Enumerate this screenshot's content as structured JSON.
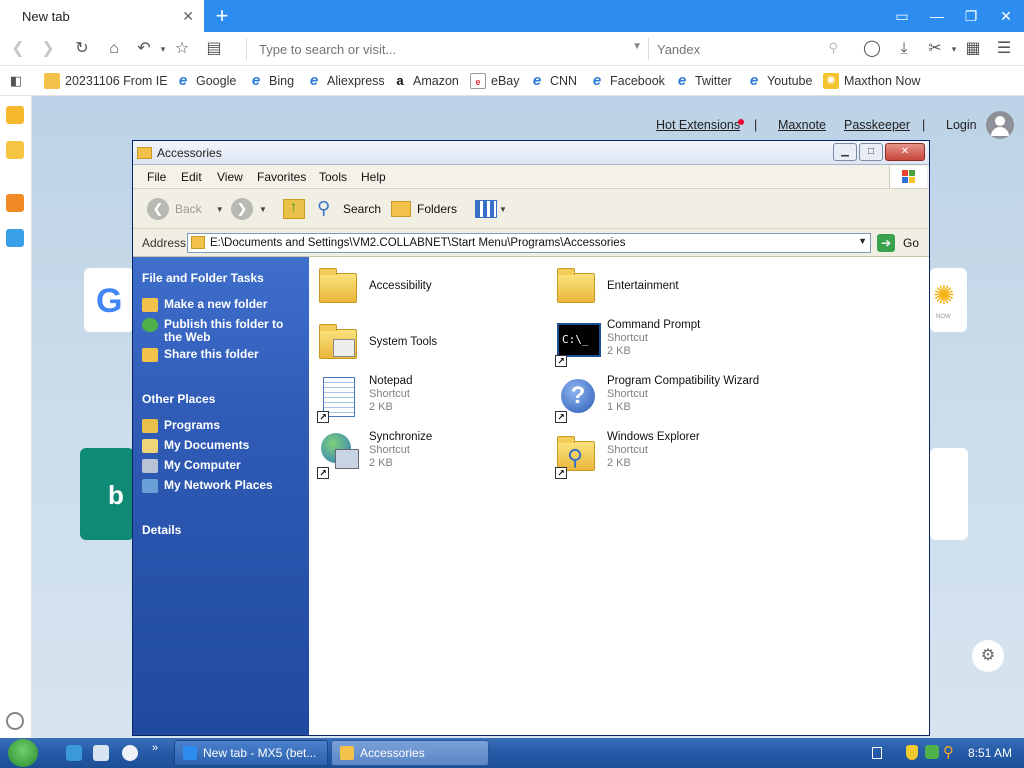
{
  "browser": {
    "tab_title": "New tab",
    "tab_close": "✕",
    "new_tab": "+",
    "url_placeholder": "Type to search or visit...",
    "search_placeholder": "Yandex"
  },
  "bookmarks": [
    {
      "label": "20231106 From IE",
      "icon": "folder-icon"
    },
    {
      "label": "Google",
      "icon": "ie-icon"
    },
    {
      "label": "Bing",
      "icon": "ie-icon"
    },
    {
      "label": "Aliexpress",
      "icon": "ie-icon"
    },
    {
      "label": "Amazon",
      "icon": "amazon-icon"
    },
    {
      "label": "eBay",
      "icon": "ebay-icon"
    },
    {
      "label": "CNN",
      "icon": "ie-icon"
    },
    {
      "label": "Facebook",
      "icon": "ie-icon"
    },
    {
      "label": "Twitter",
      "icon": "ie-icon"
    },
    {
      "label": "Youtube",
      "icon": "ie-icon"
    },
    {
      "label": "Maxthon Now",
      "icon": "maxthon-now-icon"
    }
  ],
  "page": {
    "hot_extensions": "Hot Extensions",
    "sep": "|",
    "maxnote": "Maxnote",
    "passkeeper": "Passkeeper",
    "login": "Login",
    "tile_right_caption": "NOW"
  },
  "explorer": {
    "title": "Accessories",
    "menu": [
      "File",
      "Edit",
      "View",
      "Favorites",
      "Tools",
      "Help"
    ],
    "toolbar": {
      "back": "Back",
      "search": "Search",
      "folders": "Folders"
    },
    "address_label": "Address",
    "address_value": "E:\\Documents and Settings\\VM2.COLLABNET\\Start Menu\\Programs\\Accessories",
    "go_label": "Go",
    "tasks": {
      "file_folder_header": "File and Folder Tasks",
      "make_folder": "Make a new folder",
      "publish": "Publish this folder to the Web",
      "share": "Share this folder",
      "other_header": "Other Places",
      "programs": "Programs",
      "my_documents": "My Documents",
      "my_computer": "My Computer",
      "my_network": "My Network Places",
      "details_header": "Details"
    },
    "items": [
      {
        "name": "Accessibility",
        "type": "",
        "size": ""
      },
      {
        "name": "Entertainment",
        "type": "",
        "size": ""
      },
      {
        "name": "System Tools",
        "type": "",
        "size": ""
      },
      {
        "name": "Command Prompt",
        "type": "Shortcut",
        "size": "2 KB"
      },
      {
        "name": "Notepad",
        "type": "Shortcut",
        "size": "2 KB"
      },
      {
        "name": "Program Compatibility Wizard",
        "type": "Shortcut",
        "size": "1 KB"
      },
      {
        "name": "Synchronize",
        "type": "Shortcut",
        "size": "2 KB"
      },
      {
        "name": "Windows Explorer",
        "type": "Shortcut",
        "size": "2 KB"
      }
    ]
  },
  "taskbar": {
    "task1": "New tab - MX5 (bet...",
    "task2": "Accessories",
    "clock": "8:51 AM"
  },
  "colors": {
    "browser_accent": "#2c8cf0",
    "xp_panel": "#2f5bb6",
    "taskbar": "#245aa6"
  }
}
